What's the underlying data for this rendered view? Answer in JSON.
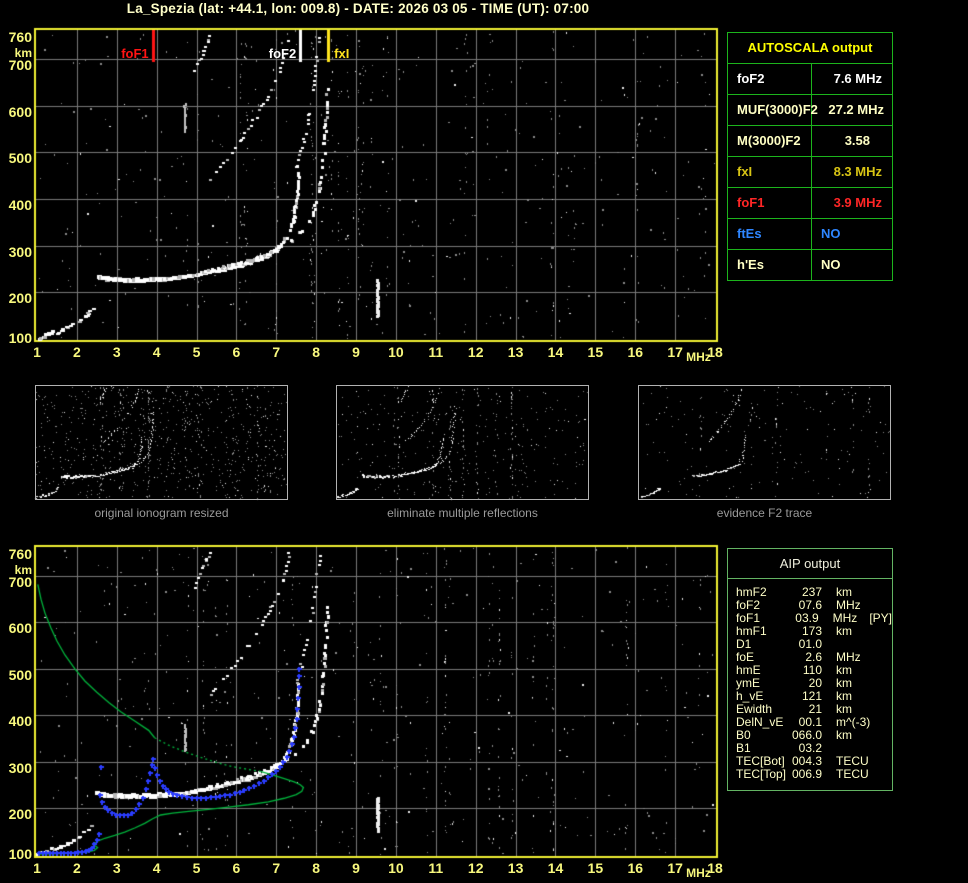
{
  "title": "La_Spezia (lat: +44.1, lon: 009.8) - DATE: 2026 03 05 - TIME (UT): 07:00",
  "autoscala_table": {
    "header": "AUTOSCALA output",
    "rows": [
      {
        "label": "foF2",
        "value": "7.6 MHz",
        "color": "#ffffff",
        "value_align": "right",
        "value_pad": 10
      },
      {
        "label": "MUF(3000)F2",
        "value": "27.2 MHz",
        "color": "#ffffc4",
        "value_align": "right",
        "value_pad": 8
      },
      {
        "label": "M(3000)F2",
        "value": "3.58",
        "color": "#ffffc4",
        "value_align": "right",
        "value_pad": 22
      },
      {
        "label": "fxI",
        "value": "8.3 MHz",
        "color": "#d8c414",
        "value_align": "right",
        "value_pad": 10
      },
      {
        "label": "foF1",
        "value": "3.9 MHz",
        "color": "#ff2626",
        "value_align": "right",
        "value_pad": 10
      },
      {
        "label": "ftEs",
        "value": "NO",
        "color": "#2e86ff",
        "value_align": "left",
        "value_pad": 9
      },
      {
        "label": "h'Es",
        "value": "NO",
        "color": "#ffffc4",
        "value_align": "left",
        "value_pad": 9
      }
    ]
  },
  "aip_table": {
    "header": "AIP output",
    "rows": [
      {
        "label": "hmF2",
        "value": "237",
        "unit": "km",
        "extra": ""
      },
      {
        "label": "foF2",
        "value": "07.6",
        "unit": "MHz",
        "extra": ""
      },
      {
        "label": "foF1",
        "value": "03.9",
        "unit": "MHz",
        "extra": "[PY]"
      },
      {
        "label": "hmF1",
        "value": "173",
        "unit": "km",
        "extra": ""
      },
      {
        "label": "D1",
        "value": "01.0",
        "unit": "",
        "extra": ""
      },
      {
        "label": "foE",
        "value": "2.6",
        "unit": "MHz",
        "extra": ""
      },
      {
        "label": "hmE",
        "value": "110",
        "unit": "km",
        "extra": ""
      },
      {
        "label": "ymE",
        "value": "20",
        "unit": "km",
        "extra": ""
      },
      {
        "label": "h_vE",
        "value": "121",
        "unit": "km",
        "extra": ""
      },
      {
        "label": "Ewidth",
        "value": "21",
        "unit": "km",
        "extra": ""
      },
      {
        "label": "DelN_vE",
        "value": "00.1",
        "unit": "m^(-3)",
        "extra": ""
      },
      {
        "label": "B0",
        "value": "066.0",
        "unit": "km",
        "extra": ""
      },
      {
        "label": "B1",
        "value": "03.2",
        "unit": "",
        "extra": ""
      },
      {
        "label": "TEC[Bot]",
        "value": "004.3",
        "unit": "TECU",
        "extra": ""
      },
      {
        "label": "TEC[Top]",
        "value": "006.9",
        "unit": "TECU",
        "extra": ""
      }
    ]
  },
  "thumbnails": [
    {
      "caption": "original ionogram resized",
      "noise": 620,
      "cols": 16,
      "seed": 21,
      "traces": [
        "e_cluster",
        "e_echoes",
        "f_flat",
        "f_riser",
        "f_asym",
        "f_x",
        "hop2_o",
        "hop2_frag"
      ]
    },
    {
      "caption": "eliminate multiple reflections",
      "noise": 260,
      "cols": 10,
      "seed": 33,
      "traces": [
        "e_cluster",
        "e_echoes",
        "f_flat",
        "f_riser",
        "f_asym",
        "f_x",
        "hop2_o",
        "hop2_frag"
      ]
    },
    {
      "caption": "evidence F2 trace",
      "noise": 160,
      "cols": 6,
      "seed": 55,
      "traces": [
        "e_cluster",
        "e_echoes",
        "f_riser",
        "f_asym",
        "hop2_o"
      ]
    }
  ],
  "chart_data": {
    "type": "scatter",
    "title": "Ionogram with AUTOSCALA interpretation",
    "x_axis": {
      "label": "MHz",
      "range": [
        1,
        18
      ],
      "ticks": [
        "1",
        "2",
        "3",
        "4",
        "5",
        "6",
        "7",
        "8",
        "9",
        "10",
        "11",
        "12",
        "13",
        "14",
        "15",
        "16",
        "17",
        "18"
      ]
    },
    "y_axis": {
      "label": "km",
      "range": [
        100,
        760
      ],
      "ticks": [
        "760",
        "700",
        "600",
        "500",
        "400",
        "300",
        "200",
        "100"
      ],
      "tick_values": [
        760,
        700,
        600,
        500,
        400,
        300,
        200,
        100
      ]
    },
    "markers": [
      {
        "label": "foF1",
        "f": 3.9,
        "color": "#ff1414",
        "side": "left"
      },
      {
        "label": "foF2",
        "f": 7.6,
        "color": "#ffffff",
        "side": "left"
      },
      {
        "label": "fxI",
        "f": 8.3,
        "color": "#ffe41e",
        "side": "right"
      }
    ],
    "traces": {
      "e_cluster": {
        "w": 4,
        "h": 3,
        "step": 3,
        "density": 0.85,
        "pts": [
          [
            1.05,
            102
          ],
          [
            1.18,
            105
          ],
          [
            1.3,
            109
          ],
          [
            1.42,
            114
          ]
        ]
      },
      "e_echoes": {
        "w": 4,
        "h": 2,
        "step": 4,
        "density": 0.75,
        "pts": [
          [
            1.5,
            112
          ],
          [
            1.62,
            117
          ],
          [
            1.76,
            123
          ],
          [
            1.9,
            130
          ],
          [
            2.05,
            138
          ],
          [
            2.2,
            147
          ],
          [
            2.32,
            156
          ],
          [
            2.4,
            163
          ]
        ]
      },
      "f_flat": {
        "w": 5,
        "h": 4,
        "step": 2,
        "density": 1,
        "pts": [
          [
            2.55,
            232
          ],
          [
            2.75,
            229
          ],
          [
            3.0,
            227
          ],
          [
            3.3,
            226
          ],
          [
            3.6,
            226
          ],
          [
            3.9,
            227
          ],
          [
            4.1,
            228
          ],
          [
            4.3,
            229
          ]
        ]
      },
      "f_riser": {
        "w": 5,
        "h": 3,
        "step": 2,
        "density": 1,
        "pts": [
          [
            4.3,
            229
          ],
          [
            4.55,
            231
          ],
          [
            4.8,
            234
          ],
          [
            5.05,
            238
          ],
          [
            5.3,
            242
          ],
          [
            5.55,
            246
          ],
          [
            5.8,
            251
          ],
          [
            6.05,
            257
          ],
          [
            6.3,
            263
          ],
          [
            6.55,
            270
          ],
          [
            6.8,
            279
          ],
          [
            7.0,
            289
          ],
          [
            7.1,
            296
          ]
        ]
      },
      "f_asym": {
        "w": 3,
        "h": 3,
        "step": 3,
        "density": 0.85,
        "pts": [
          [
            7.1,
            296
          ],
          [
            7.2,
            308
          ],
          [
            7.3,
            322
          ],
          [
            7.38,
            339
          ],
          [
            7.44,
            358
          ],
          [
            7.49,
            380
          ],
          [
            7.52,
            404
          ],
          [
            7.54,
            428
          ],
          [
            7.55,
            450
          ],
          [
            7.56,
            470
          ]
        ]
      },
      "f_x": {
        "w": 3,
        "h": 3,
        "step": 4,
        "density": 0.7,
        "pts": [
          [
            5.1,
            241
          ],
          [
            5.4,
            247
          ],
          [
            5.7,
            253
          ],
          [
            6.0,
            260
          ],
          [
            6.3,
            268
          ],
          [
            6.6,
            277
          ],
          [
            6.9,
            287
          ],
          [
            7.15,
            298
          ],
          [
            7.4,
            311
          ],
          [
            7.6,
            326
          ],
          [
            7.78,
            344
          ],
          [
            7.92,
            366
          ],
          [
            8.02,
            392
          ],
          [
            8.1,
            422
          ],
          [
            8.15,
            452
          ],
          [
            8.19,
            484
          ],
          [
            8.22,
            520
          ],
          [
            8.25,
            560
          ],
          [
            8.27,
            600
          ],
          [
            8.29,
            640
          ]
        ]
      },
      "hop2_o": {
        "w": 3,
        "h": 2,
        "step": 5,
        "density": 0.6,
        "pts": [
          [
            5.3,
            436
          ],
          [
            5.5,
            456
          ],
          [
            5.7,
            478
          ],
          [
            5.9,
            500
          ],
          [
            6.1,
            524
          ],
          [
            6.3,
            549
          ],
          [
            6.5,
            576
          ],
          [
            6.7,
            604
          ],
          [
            6.88,
            633
          ],
          [
            7.03,
            662
          ],
          [
            7.16,
            692
          ],
          [
            7.26,
            722
          ],
          [
            7.33,
            748
          ]
        ]
      },
      "hop2_frag": {
        "w": 3,
        "h": 2,
        "step": 4,
        "density": 0.7,
        "pts": [
          [
            4.95,
            676
          ],
          [
            5.07,
            696
          ],
          [
            5.18,
            716
          ],
          [
            5.28,
            736
          ],
          [
            5.36,
            754
          ]
        ]
      },
      "hop2_x": {
        "w": 3,
        "h": 2,
        "step": 5,
        "density": 0.6,
        "pts": [
          [
            7.52,
            468
          ],
          [
            7.62,
            502
          ],
          [
            7.72,
            540
          ],
          [
            7.82,
            580
          ],
          [
            7.9,
            622
          ],
          [
            7.98,
            664
          ],
          [
            8.04,
            706
          ],
          [
            8.09,
            744
          ]
        ]
      }
    },
    "streaks": {
      "top": [
        {
          "f": 9.55,
          "h1": 148,
          "h2": 228,
          "color": "#f0f0f0",
          "w": 3
        },
        {
          "f": 4.72,
          "h1": 545,
          "h2": 605,
          "color": "#c0c0c0",
          "w": 2
        }
      ],
      "bottom": [
        {
          "f": 9.55,
          "h1": 150,
          "h2": 226,
          "color": "#f0f0f0",
          "w": 3
        },
        {
          "f": 4.72,
          "h1": 318,
          "h2": 380,
          "color": "#c0c0c0",
          "w": 2
        }
      ]
    },
    "profile_green": {
      "color": "#00b43c",
      "solid1": [
        [
          1.02,
          682
        ],
        [
          1.1,
          650
        ],
        [
          1.2,
          620
        ],
        [
          1.35,
          588
        ],
        [
          1.5,
          560
        ],
        [
          1.7,
          530
        ],
        [
          1.95,
          500
        ],
        [
          2.2,
          474
        ],
        [
          2.5,
          450
        ],
        [
          2.8,
          428
        ],
        [
          3.1,
          408
        ],
        [
          3.45,
          388
        ],
        [
          3.8,
          368
        ],
        [
          3.95,
          352
        ]
      ],
      "dotted": [
        [
          3.95,
          352
        ],
        [
          4.3,
          336
        ],
        [
          4.7,
          322
        ],
        [
          5.1,
          310
        ],
        [
          5.5,
          299
        ],
        [
          5.9,
          290
        ],
        [
          6.3,
          284
        ],
        [
          6.6,
          280
        ]
      ],
      "solid2": [
        [
          6.6,
          280
        ],
        [
          6.9,
          272
        ],
        [
          7.2,
          264
        ],
        [
          7.45,
          257
        ],
        [
          7.6,
          251
        ],
        [
          7.68,
          245
        ],
        [
          7.64,
          237
        ],
        [
          7.5,
          230
        ],
        [
          7.2,
          222
        ],
        [
          6.8,
          214
        ],
        [
          6.3,
          208
        ],
        [
          5.8,
          203
        ],
        [
          5.3,
          198
        ],
        [
          4.8,
          194
        ],
        [
          4.4,
          190
        ],
        [
          4.1,
          186
        ],
        [
          3.9,
          178
        ],
        [
          3.7,
          168
        ],
        [
          3.45,
          158
        ],
        [
          3.2,
          149
        ],
        [
          2.95,
          142
        ],
        [
          2.7,
          136
        ],
        [
          2.52,
          130
        ],
        [
          2.42,
          122
        ],
        [
          2.52,
          116
        ],
        [
          2.44,
          110
        ],
        [
          2.25,
          106
        ],
        [
          2.0,
          104
        ],
        [
          1.6,
          103
        ],
        [
          1.05,
          102
        ]
      ]
    },
    "restored_blue": {
      "color": "#2a3cff",
      "pts": [
        [
          1.05,
          104
        ],
        [
          1.14,
          104
        ],
        [
          1.23,
          104
        ],
        [
          1.32,
          104
        ],
        [
          1.41,
          104
        ],
        [
          1.5,
          104
        ],
        [
          1.59,
          104
        ],
        [
          1.68,
          105
        ],
        [
          1.77,
          105
        ],
        [
          1.86,
          105
        ],
        [
          1.95,
          105
        ],
        [
          2.04,
          106
        ],
        [
          2.13,
          106
        ],
        [
          2.22,
          108
        ],
        [
          2.3,
          111
        ],
        [
          2.38,
          116
        ],
        [
          2.44,
          123
        ],
        [
          2.5,
          133
        ],
        [
          2.55,
          146
        ],
        [
          2.58,
          230
        ],
        [
          2.63,
          214
        ],
        [
          2.7,
          204
        ],
        [
          2.78,
          196
        ],
        [
          2.87,
          190
        ],
        [
          2.97,
          186
        ],
        [
          3.07,
          185
        ],
        [
          3.17,
          185
        ],
        [
          3.27,
          187
        ],
        [
          3.37,
          191
        ],
        [
          3.47,
          198
        ],
        [
          3.57,
          209
        ],
        [
          3.66,
          223
        ],
        [
          3.73,
          241
        ],
        [
          3.79,
          259
        ],
        [
          3.84,
          277
        ],
        [
          3.88,
          293
        ],
        [
          3.91,
          306
        ],
        [
          3.97,
          288
        ],
        [
          4.02,
          272
        ],
        [
          4.08,
          259
        ],
        [
          4.15,
          249
        ],
        [
          4.23,
          242
        ],
        [
          4.32,
          236
        ],
        [
          4.42,
          231
        ],
        [
          4.52,
          228
        ],
        [
          4.64,
          226
        ],
        [
          4.76,
          224
        ],
        [
          4.88,
          223
        ],
        [
          5.0,
          223
        ],
        [
          5.12,
          223
        ],
        [
          5.24,
          223
        ],
        [
          5.36,
          224
        ],
        [
          5.48,
          225
        ],
        [
          5.6,
          226
        ],
        [
          5.72,
          228
        ],
        [
          5.84,
          230
        ],
        [
          5.96,
          233
        ],
        [
          6.08,
          236
        ],
        [
          6.2,
          240
        ],
        [
          6.32,
          244
        ],
        [
          6.44,
          249
        ],
        [
          6.56,
          254
        ],
        [
          6.68,
          260
        ],
        [
          6.8,
          267
        ],
        [
          6.9,
          274
        ],
        [
          7.0,
          281
        ],
        [
          7.1,
          290
        ],
        [
          7.18,
          300
        ],
        [
          7.26,
          311
        ],
        [
          7.33,
          324
        ],
        [
          7.39,
          338
        ],
        [
          7.44,
          354
        ],
        [
          7.48,
          372
        ],
        [
          7.51,
          392
        ],
        [
          7.53,
          414
        ],
        [
          7.55,
          438
        ],
        [
          7.56,
          462
        ],
        [
          7.57,
          484
        ],
        [
          7.58,
          500
        ],
        [
          2.6,
          290
        ]
      ]
    }
  }
}
